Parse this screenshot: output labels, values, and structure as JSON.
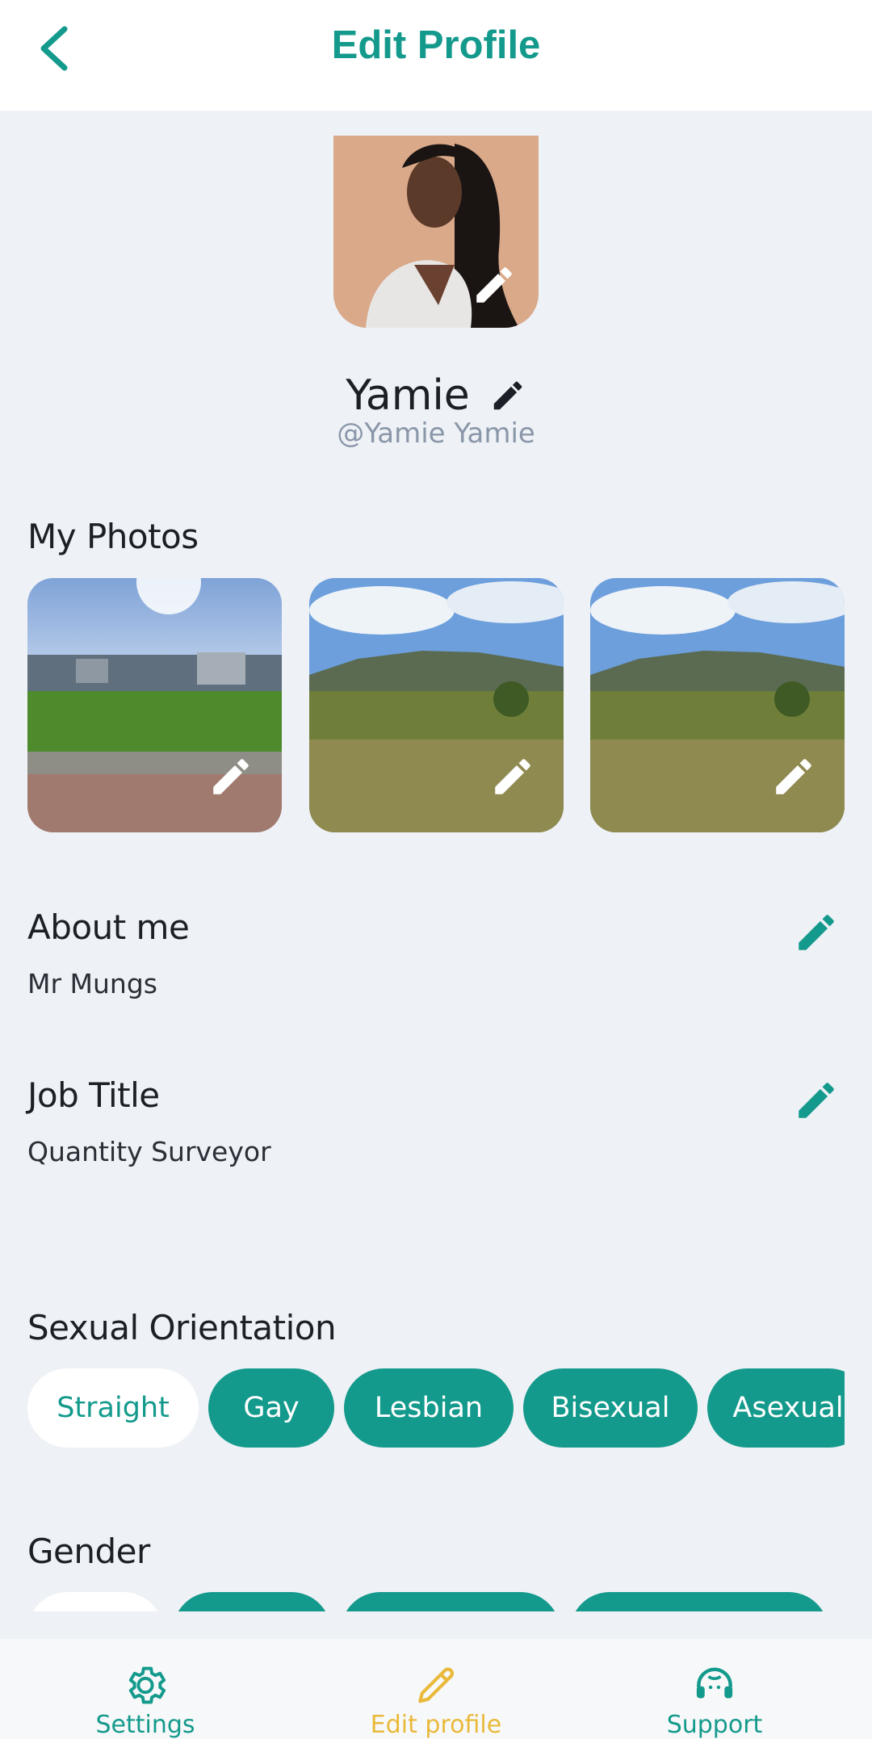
{
  "header": {
    "title": "Edit Profile"
  },
  "profile": {
    "name": "Yamie",
    "username": "@Yamie Yamie"
  },
  "photos": {
    "title": "My Photos",
    "count": 3
  },
  "about": {
    "title": "About me",
    "value": "Mr Mungs"
  },
  "job": {
    "title": "Job Title",
    "value": "Quantity Surveyor"
  },
  "orientation": {
    "title": "Sexual Orientation",
    "options": [
      "Straight",
      "Gay",
      "Lesbian",
      "Bisexual",
      "Asexual"
    ],
    "selected": "Straight"
  },
  "gender": {
    "title": "Gender"
  },
  "nav": {
    "settings": "Settings",
    "edit_profile": "Edit profile",
    "support": "Support"
  },
  "colors": {
    "accent": "#149a8c",
    "active_nav": "#e9b93a",
    "background": "#eef1f6"
  },
  "icons": [
    "back-chevron-icon",
    "pencil-icon",
    "gear-icon",
    "headset-icon"
  ]
}
